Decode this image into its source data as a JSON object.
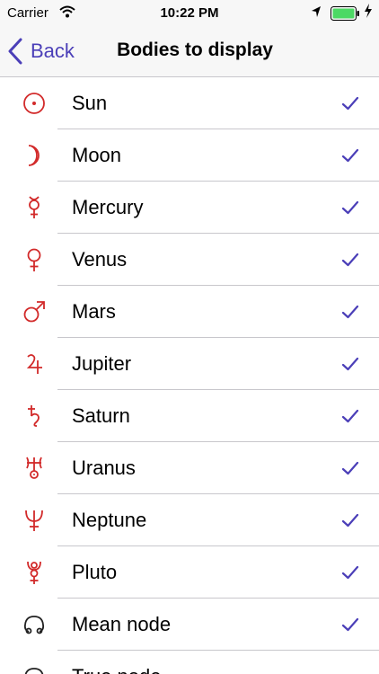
{
  "status": {
    "carrier": "Carrier",
    "time": "10:22 PM"
  },
  "nav": {
    "back_label": "Back",
    "title": "Bodies to display"
  },
  "colors": {
    "accent": "#4b3fb8",
    "symbol_red": "#d22a2a",
    "symbol_dark": "#222222"
  },
  "bodies": [
    {
      "name": "Sun",
      "symbol": "sun-icon",
      "checked": true
    },
    {
      "name": "Moon",
      "symbol": "moon-icon",
      "checked": true
    },
    {
      "name": "Mercury",
      "symbol": "mercury-icon",
      "checked": true
    },
    {
      "name": "Venus",
      "symbol": "venus-icon",
      "checked": true
    },
    {
      "name": "Mars",
      "symbol": "mars-icon",
      "checked": true
    },
    {
      "name": "Jupiter",
      "symbol": "jupiter-icon",
      "checked": true
    },
    {
      "name": "Saturn",
      "symbol": "saturn-icon",
      "checked": true
    },
    {
      "name": "Uranus",
      "symbol": "uranus-icon",
      "checked": true
    },
    {
      "name": "Neptune",
      "symbol": "neptune-icon",
      "checked": true
    },
    {
      "name": "Pluto",
      "symbol": "pluto-icon",
      "checked": true
    },
    {
      "name": "Mean node",
      "symbol": "node-icon",
      "checked": true
    },
    {
      "name": "True node",
      "symbol": "node-icon",
      "checked": false
    }
  ]
}
